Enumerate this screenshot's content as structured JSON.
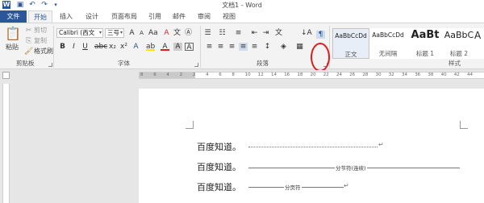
{
  "window": {
    "title": "文档1 - Word"
  },
  "quick_access": {
    "icons": [
      "word-icon",
      "save-icon",
      "undo-icon",
      "redo-icon",
      "customize-icon"
    ]
  },
  "tabs": {
    "file": "文件",
    "items": [
      "开始",
      "插入",
      "设计",
      "页面布局",
      "引用",
      "邮件",
      "审阅",
      "视图"
    ],
    "active": "开始"
  },
  "ribbon": {
    "clipboard": {
      "paste": "粘贴",
      "cut": "剪切",
      "copy": "复制",
      "format_painter": "格式刷",
      "label": "剪贴板"
    },
    "font": {
      "name": "Calibri (西文",
      "size": "三号",
      "label": "字体",
      "bold": "B",
      "italic": "I",
      "underline": "U"
    },
    "paragraph": {
      "label": "段落"
    },
    "styles": {
      "label": "样式",
      "items": [
        {
          "sample": "AaBbCcDd",
          "name": "正文",
          "selected": true
        },
        {
          "sample": "AaBbCcDd",
          "name": "无间隔",
          "selected": false
        },
        {
          "sample": "AaBt",
          "name": "标题 1",
          "selected": false
        },
        {
          "sample": "AaBbC",
          "name": "标题 2",
          "selected": false
        },
        {
          "sample": "A",
          "name": "",
          "selected": false
        }
      ]
    },
    "highlight_color": "#e01b1b"
  },
  "ruler": {
    "ticks": [
      "8",
      "6",
      "4",
      "2",
      "2",
      "4",
      "6",
      "8",
      "10",
      "12",
      "14",
      "16",
      "18",
      "20",
      "22",
      "24",
      "26",
      "28",
      "30",
      "32",
      "34",
      "36",
      "38",
      "40",
      "42",
      "44"
    ]
  },
  "document": {
    "lines": [
      {
        "text": "百度知道。",
        "mark": "↵"
      },
      {
        "text": "百度知道。",
        "break_label": "分节符(连续)"
      },
      {
        "text": "百度知道。",
        "break_label": "分页符",
        "mark": "↵"
      }
    ]
  }
}
